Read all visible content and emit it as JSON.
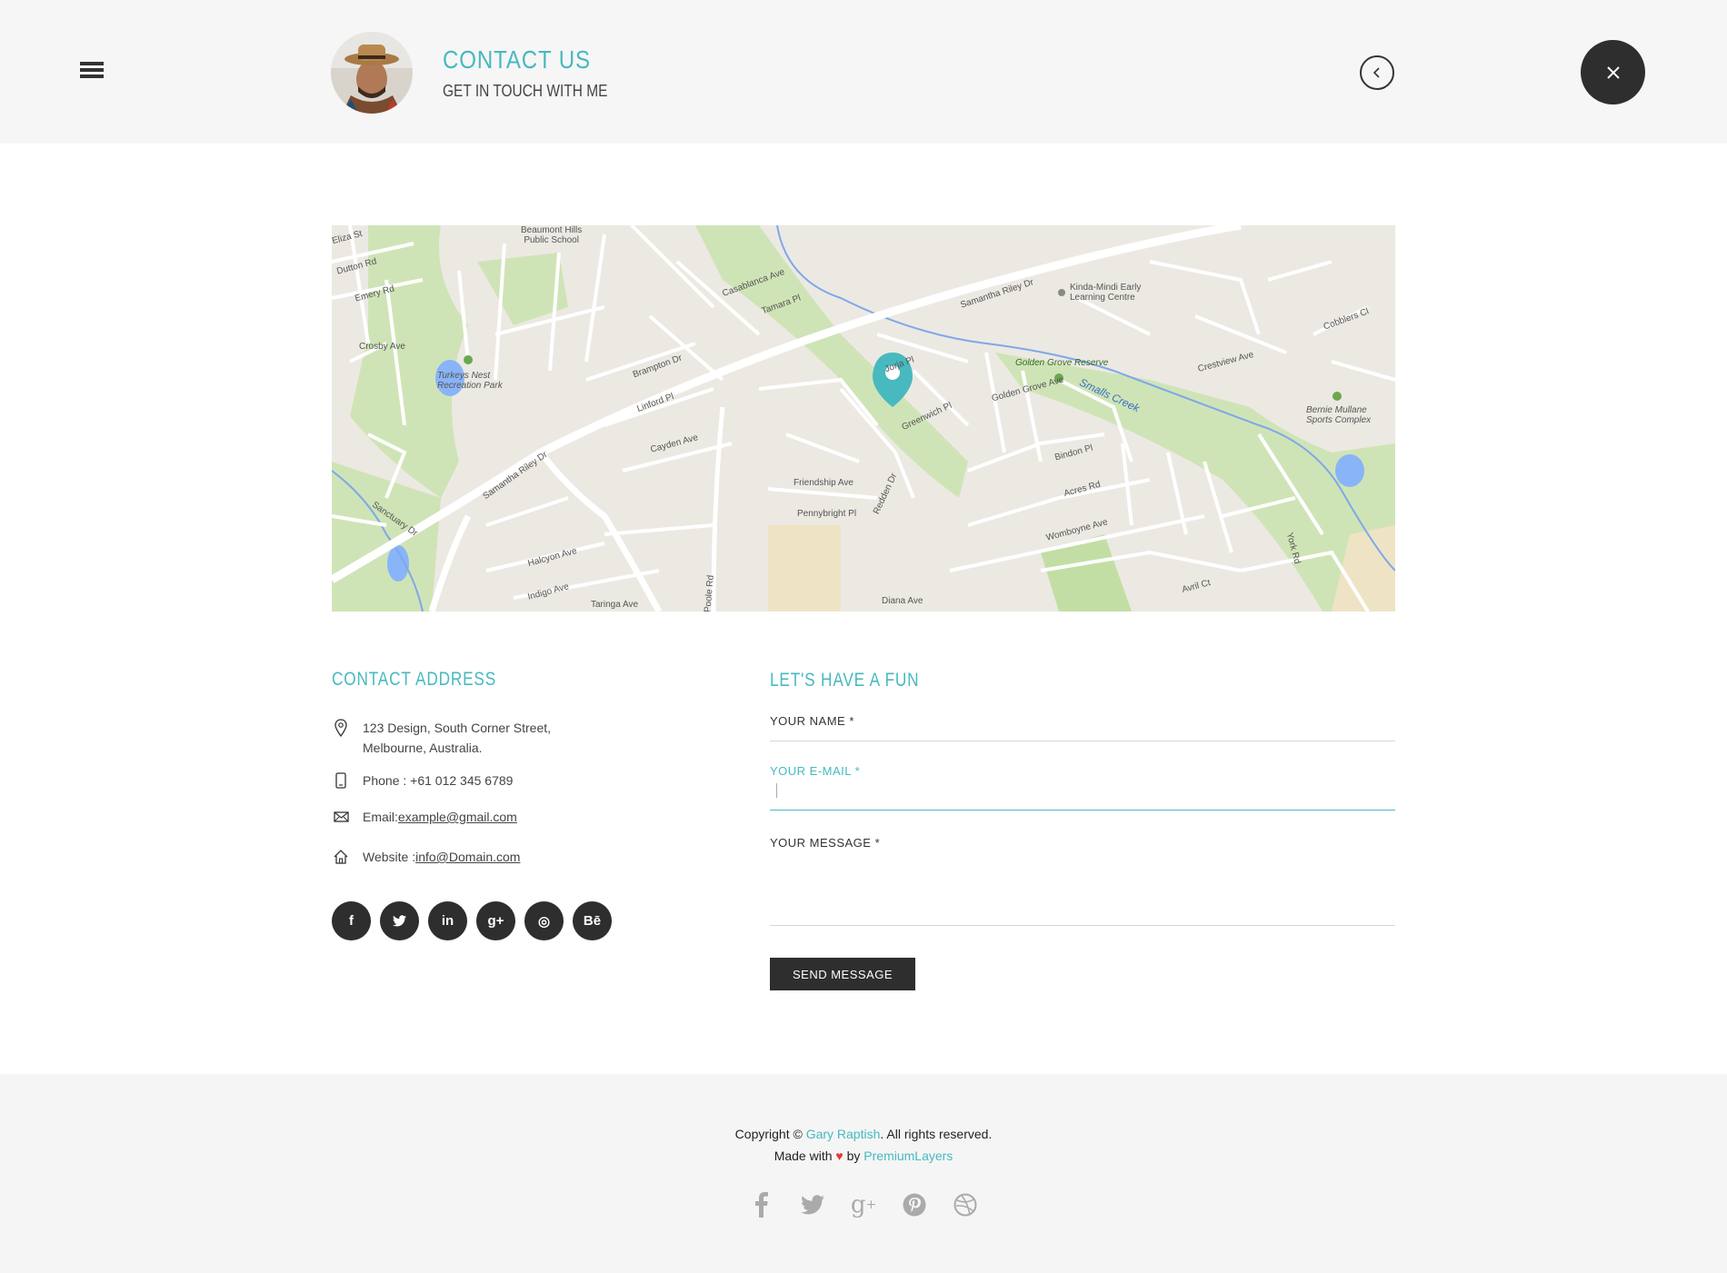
{
  "header": {
    "title": "CONTACT US",
    "subtitle": "GET IN TOUCH WITH ME"
  },
  "map": {
    "labels": {
      "school": "Beaumont Hills\nPublic School",
      "early_learning": "Kinda-Mindi Early\nLearning Centre",
      "park": "Turkeys Nest\nRecreation Park",
      "reserve": "Golden Grove Reserve",
      "creek": "Smalls Creek",
      "sports": "Bernie Mullane\nSports Complex",
      "samantha1": "Samantha Riley Dr",
      "samantha2": "Samantha Riley Dr",
      "brampton": "Brampton Dr",
      "linford": "Linford Pl",
      "cayden": "Cayden Ave",
      "friendship": "Friendship Ave",
      "pennybright": "Pennybright Pl",
      "redden": "Redden Dr",
      "golden_grove_ave": "Golden Grove Ave",
      "bindon": "Bindon Pl",
      "acres": "Acres Rd",
      "womboyne": "Womboyne Ave",
      "crestview": "Crestview Ave",
      "sanctuary": "Sanctuary Dr",
      "halcyon": "Halcyon Ave",
      "indigo": "Indigo Ave",
      "taringa": "Taringa Ave",
      "diana": "Diana Ave",
      "crosby": "Crosby Ave",
      "emery": "Emery Rd",
      "dutton": "Dutton Rd",
      "eliza": "Eliza St",
      "casablanca": "Casablanca Ave",
      "tamara": "Tamara Pl",
      "jorja": "Jorja Pl",
      "greenwich": "Greenwich Pl",
      "cobblers": "Cobblers Cl",
      "avril": "Avril Ct",
      "york": "York Rd",
      "poole": "Poole Rd"
    },
    "pin_color": "#47b9bf"
  },
  "contact": {
    "title": "CONTACT ADDRESS",
    "address_line1": "123 Design, South Corner Street,",
    "address_line2": "Melbourne, Australia.",
    "phone": "Phone : +61 012 345 6789",
    "email_label": "Email: ",
    "email": "example@gmail.com",
    "website_label": "Website : ",
    "website": "info@Domain.com",
    "socials": [
      {
        "name": "facebook-icon",
        "glyph": "f"
      },
      {
        "name": "twitter-icon",
        "glyph": "t"
      },
      {
        "name": "linkedin-icon",
        "glyph": "in"
      },
      {
        "name": "google-plus-icon",
        "glyph": "g+"
      },
      {
        "name": "dribbble-icon",
        "glyph": "◎"
      },
      {
        "name": "behance-icon",
        "glyph": "Bē"
      }
    ]
  },
  "form": {
    "title": "LET'S HAVE A FUN",
    "name_label": "YOUR NAME  *",
    "email_label": "YOUR E-MAIL  *",
    "message_label": "YOUR MESSAGE  *",
    "name_value": "",
    "email_value": "",
    "message_value": "",
    "send_label": "SEND MESSAGE"
  },
  "footer": {
    "copyright_prefix": "Copyright © ",
    "copyright_name": "Gary Raptish",
    "copyright_suffix": ". All rights reserved.",
    "made_prefix": "Made with ",
    "made_by": " by ",
    "made_company": "PremiumLayers",
    "icons": [
      "facebook-icon",
      "twitter-icon",
      "google-plus-icon",
      "pinterest-icon",
      "dribbble-icon"
    ]
  },
  "colors": {
    "accent": "#47b9bf",
    "dark": "#2e2e2e",
    "header_bg": "#f6f6f6",
    "footer_bg": "#f5f5f5",
    "map_water": "#8ab4f8",
    "map_green": "#c8e6a0"
  }
}
